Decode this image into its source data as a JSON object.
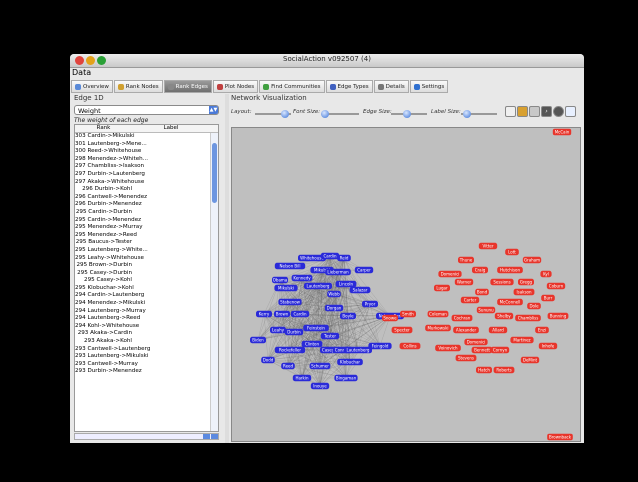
{
  "window": {
    "title": "SocialAction v092507 (4)",
    "menu": "Data"
  },
  "tabs": [
    {
      "label": "Overview",
      "icon": "overview-icon",
      "color": "#5a8ad8"
    },
    {
      "label": "Rank Nodes",
      "icon": "rank-nodes-icon",
      "color": "#d0a030"
    },
    {
      "label": "Rank Edges",
      "icon": "rank-edges-icon",
      "color": "#888888",
      "active": true
    },
    {
      "label": "Plot Nodes",
      "icon": "plot-nodes-icon",
      "color": "#c04040"
    },
    {
      "label": "Find Communities",
      "icon": "communities-icon",
      "color": "#40a040"
    },
    {
      "label": "Edge Types",
      "icon": "edge-types-icon",
      "color": "#4060c0"
    },
    {
      "label": "Details",
      "icon": "details-icon",
      "color": "#777777"
    },
    {
      "label": "Settings",
      "icon": "settings-icon",
      "color": "#3070d0"
    }
  ],
  "left_panel": {
    "title": "Edge 1D",
    "metric": "Weight",
    "description": "The weight of each edge",
    "columns": [
      "Rank",
      "Label"
    ],
    "rows": [
      [
        "",
        "303 Cardin->Mikulski"
      ],
      [
        "",
        "301 Lautenberg->Mene..."
      ],
      [
        "",
        "300 Reed->Whitehouse"
      ],
      [
        "",
        "298 Menendez->Whiteh..."
      ],
      [
        "",
        "297 Chambliss->Isakson"
      ],
      [
        "",
        "297 Durbin->Lautenberg"
      ],
      [
        "",
        "297 Akaka->Whitehouse"
      ],
      [
        "",
        "296 Durbin->Kohl"
      ],
      [
        "",
        "296 Cantwell->Menendez"
      ],
      [
        "",
        "296 Durbin->Menendez"
      ],
      [
        "",
        "295 Cardin->Durbin"
      ],
      [
        "",
        "295 Cardin->Menendez"
      ],
      [
        "",
        "295 Menendez->Murray"
      ],
      [
        "",
        "295 Menendez->Reed"
      ],
      [
        "",
        "295 Baucus->Tester"
      ],
      [
        "",
        "295 Lautenberg->White..."
      ],
      [
        "",
        "295 Leahy->Whitehouse"
      ],
      [
        "",
        "295 Brown->Durbin"
      ],
      [
        "",
        "295 Casey->Durbin"
      ],
      [
        "",
        "295 Casey->Kohl"
      ],
      [
        "",
        "295 Klobuchar->Kohl"
      ],
      [
        "",
        "294 Cardin->Lautenberg"
      ],
      [
        "",
        "294 Menendez->Mikulski"
      ],
      [
        "",
        "294 Lautenberg->Murray"
      ],
      [
        "",
        "294 Lautenberg->Reed"
      ],
      [
        "",
        "294 Kohl->Whitehouse"
      ],
      [
        "",
        "293 Akaka->Cardin"
      ],
      [
        "",
        "293 Akaka->Kohl"
      ],
      [
        "",
        "293 Cantwell->Lautenberg"
      ],
      [
        "",
        "293 Lautenberg->Mikulski"
      ],
      [
        "",
        "293 Cantwell->Murray"
      ],
      [
        "",
        "293 Durbin->Menendez"
      ]
    ]
  },
  "right_panel": {
    "title": "Network Visualization",
    "layout_label": "Layout:",
    "font_size_label": "Font Size:",
    "edge_size_label": "Edge Size:",
    "label_size_label": "Label Size:"
  },
  "graph": {
    "blue_color": "#2a2ad8",
    "red_color": "#e8352b",
    "blue_nodes": [
      [
        "Whitehouse",
        70,
        40
      ],
      [
        "Cardin",
        88,
        38
      ],
      [
        "Reid",
        102,
        40
      ],
      [
        "Nelson Bill",
        48,
        48
      ],
      [
        "Mikulski",
        80,
        52
      ],
      [
        "Lieberman",
        96,
        54
      ],
      [
        "Carper",
        122,
        52
      ],
      [
        "Obama",
        38,
        62
      ],
      [
        "Kennedy",
        60,
        60
      ],
      [
        "Mikulski",
        44,
        70
      ],
      [
        "Lautenberg",
        76,
        68
      ],
      [
        "Lincoln",
        104,
        66
      ],
      [
        "Salazar",
        118,
        72
      ],
      [
        "Stabenow",
        48,
        84
      ],
      [
        "Pryor",
        128,
        86
      ],
      [
        "Dorgan",
        92,
        90
      ],
      [
        "Kerry",
        22,
        96
      ],
      [
        "Brown",
        40,
        96
      ],
      [
        "Cardin",
        58,
        96
      ],
      [
        "Boyle",
        106,
        98
      ],
      [
        "Nelson Ben",
        148,
        98
      ],
      [
        "Leahy",
        36,
        112
      ],
      [
        "Durbin",
        52,
        114
      ],
      [
        "Feinstein",
        74,
        110
      ],
      [
        "Biden",
        16,
        122
      ],
      [
        "Clinton",
        70,
        126
      ],
      [
        "Rockefeller",
        48,
        132
      ],
      [
        "Casey",
        86,
        132
      ],
      [
        "Conrad",
        100,
        132
      ],
      [
        "Lautenberg",
        116,
        132
      ],
      [
        "Feingold",
        138,
        128
      ],
      [
        "Dodd",
        26,
        142
      ],
      [
        "Reed",
        46,
        148
      ],
      [
        "Schumer",
        78,
        148
      ],
      [
        "Klobuchar",
        108,
        144
      ],
      [
        "Harkin",
        60,
        160
      ],
      [
        "Bingaman",
        104,
        160
      ],
      [
        "Inouye",
        78,
        168
      ],
      [
        "Tester",
        88,
        118
      ],
      [
        "Webb",
        92,
        76
      ]
    ],
    "red_nodes": [
      [
        "Vitter",
        246,
        28
      ],
      [
        "Lott",
        270,
        34
      ],
      [
        "Thune",
        224,
        42
      ],
      [
        "Graham",
        290,
        42
      ],
      [
        "Craig",
        238,
        52
      ],
      [
        "Hutchison",
        268,
        52
      ],
      [
        "Domenici",
        208,
        56
      ],
      [
        "Kyl",
        304,
        56
      ],
      [
        "Warner",
        222,
        64
      ],
      [
        "Sessions",
        260,
        64
      ],
      [
        "Gregg",
        284,
        64
      ],
      [
        "Coburn",
        314,
        68
      ],
      [
        "Lugar",
        200,
        70
      ],
      [
        "Bond",
        240,
        74
      ],
      [
        "Isakson",
        282,
        74
      ],
      [
        "Burr",
        306,
        80
      ],
      [
        "Carter",
        228,
        82
      ],
      [
        "McConnell",
        268,
        84
      ],
      [
        "Dole",
        292,
        88
      ],
      [
        "Smith",
        166,
        96
      ],
      [
        "Coleman",
        196,
        96
      ],
      [
        "Sununu",
        244,
        92
      ],
      [
        "Shelby",
        262,
        98
      ],
      [
        "Bunning",
        316,
        98
      ],
      [
        "Snowe",
        148,
        100
      ],
      [
        "Cochran",
        220,
        100
      ],
      [
        "Chambliss",
        286,
        100
      ],
      [
        "Specter",
        160,
        112
      ],
      [
        "Murkowski",
        196,
        110
      ],
      [
        "Alexander",
        224,
        112
      ],
      [
        "Allard",
        256,
        112
      ],
      [
        "Enzi",
        300,
        112
      ],
      [
        "Martinez",
        280,
        122
      ],
      [
        "Collins",
        168,
        128
      ],
      [
        "Domenici",
        234,
        124
      ],
      [
        "Voinovich",
        206,
        130
      ],
      [
        "Bennett",
        240,
        132
      ],
      [
        "Cornyn",
        258,
        132
      ],
      [
        "Inhofe",
        306,
        128
      ],
      [
        "Stevens",
        224,
        140
      ],
      [
        "DeMint",
        288,
        142
      ],
      [
        "Hatch",
        242,
        152
      ],
      [
        "Roberts",
        262,
        152
      ]
    ],
    "corner_labels": [
      "McCain",
      "Brownback"
    ]
  }
}
